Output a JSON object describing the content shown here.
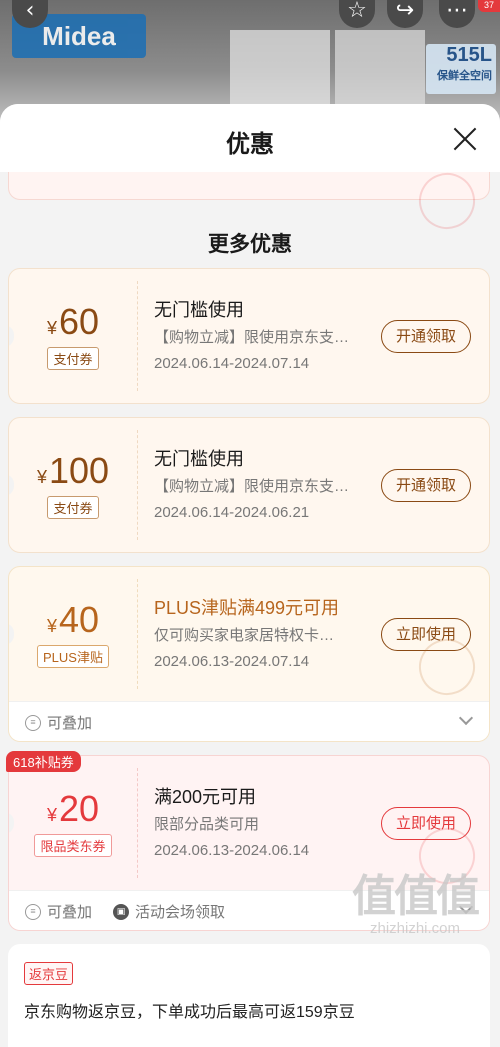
{
  "background": {
    "brand": "Midea",
    "tag_main": "515L",
    "tag_sub": "保鲜全空间",
    "notification_count": "37"
  },
  "sheet": {
    "title": "优惠",
    "section_title": "更多优惠"
  },
  "coupons": [
    {
      "amount": "60",
      "currency": "¥",
      "tag": "支付券",
      "title": "无门槛使用",
      "desc": "【购物立减】限使用京东支…",
      "date": "2024.06.14-2024.07.14",
      "button": "开通领取",
      "accent": "#8a4a14",
      "bg": "#fff7ef"
    },
    {
      "amount": "100",
      "currency": "¥",
      "tag": "支付券",
      "title": "无门槛使用",
      "desc": "【购物立减】限使用京东支…",
      "date": "2024.06.14-2024.06.21",
      "button": "开通领取",
      "accent": "#8a4a14",
      "bg": "#fff7ef"
    },
    {
      "amount": "40",
      "currency": "¥",
      "tag": "PLUS津贴",
      "title": "PLUS津贴满499元可用",
      "desc": "仅可购买家电家居特权卡…",
      "date": "2024.06.13-2024.07.14",
      "button": "立即使用",
      "accent": "#b7651d",
      "bg": "#fff8ee",
      "footer": [
        "可叠加"
      ]
    },
    {
      "amount": "20",
      "currency": "¥",
      "tag": "限品类东券",
      "title": "满200元可用",
      "desc": "限部分品类可用",
      "date": "2024.06.13-2024.06.14",
      "button": "立即使用",
      "accent": "#e4393c",
      "bg": "#fff3f3",
      "badge": "618补贴券",
      "footer": [
        "可叠加",
        "活动会场领取"
      ]
    }
  ],
  "bean": {
    "tag": "返京豆",
    "text": "京东购物返京豆，下单成功后最高可返159京豆"
  },
  "watermark": {
    "main": "值值值",
    "domain": "zhizhizhi.com"
  }
}
